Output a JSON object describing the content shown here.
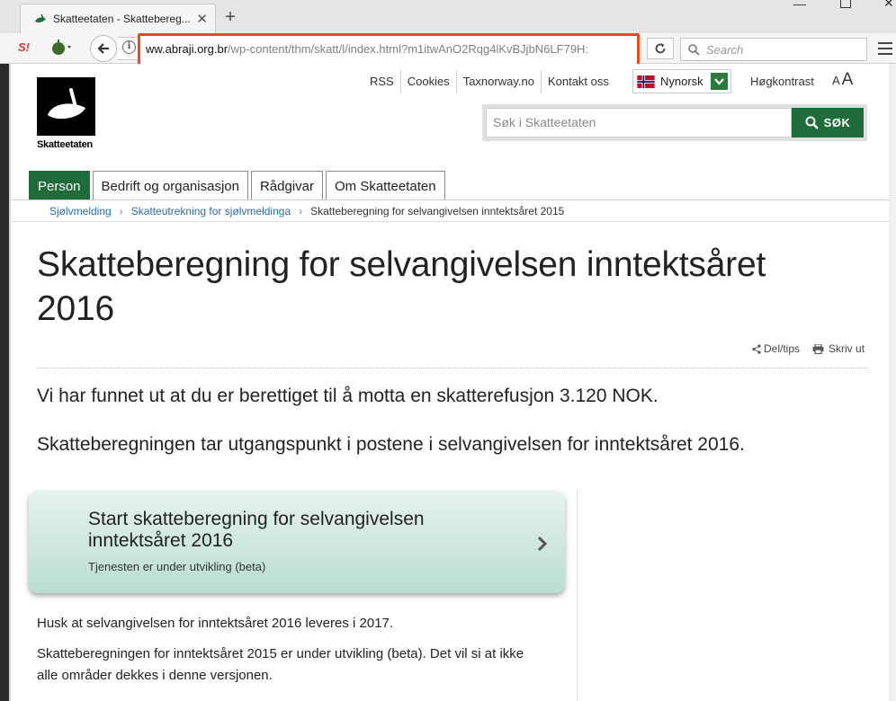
{
  "browser": {
    "tab_title": "Skatteetaten - Skattebereg...",
    "url_domain": "ww.abraji.org.br",
    "url_path": "/wp-content/thm/skatt/l/index.html?m1itwAnO2Rqg4lKvBJjbN6LF79H:",
    "search_placeholder": "Search",
    "toolbar_badge": "S!"
  },
  "site": {
    "logo_caption": "Skatteetaten",
    "toplinks": [
      "RSS",
      "Cookies",
      "Taxnorway.no",
      "Kontakt oss"
    ],
    "language": "Nynorsk",
    "contrast_label": "Høgkontrast",
    "font_small": "A",
    "font_large": "A",
    "search_placeholder": "Søk i Skatteetaten",
    "search_button": "SØK",
    "tabs": [
      "Person",
      "Bedrift og organisasjon",
      "Rådgivar",
      "Om Skatteetaten"
    ],
    "breadcrumb": [
      "Sjølvmelding",
      "Skatteutrekning for sjølvmeldinga",
      "Skatteberegning for selvangivelsen inntektsåret 2015"
    ],
    "accent_color": "#1f6b3a"
  },
  "content": {
    "title": "Skatteberegning for selvangivelsen inntektsåret 2016",
    "share_label": "Del/tips",
    "print_label": "Skriv ut",
    "lead_1": "Vi har funnet ut at du er berettiget til å motta en skatterefusjon 3.120 NOK.",
    "lead_2": "Skatteberegningen tar utgangspunkt i postene i selvangivelsen for inntektsåret 2016.",
    "card_title": "Start skatteberegning for selvangivelsen inntektsåret 2016",
    "card_subtitle": "Tjenesten er under utvikling (beta)",
    "note_1": "Husk at selvangivelsen for inntektsåret 2016 leveres i 2017.",
    "note_2": "Skatteberegningen for inntektsåret 2015 er under utvikling (beta). Det vil si at ikke alle områder dekkes i denne versjonen."
  }
}
